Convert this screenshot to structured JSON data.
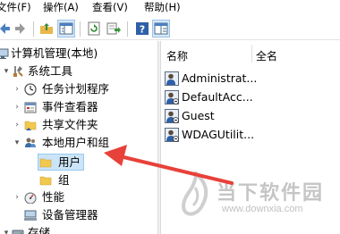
{
  "menu": [
    "文件(F)",
    "操作(A)",
    "查看(V)",
    "帮助(H)"
  ],
  "toolbar": {
    "buttons": [
      "back-icon",
      "forward-icon",
      "up-folder-icon",
      "show-tree-icon",
      "refresh-icon",
      "export-list-icon",
      "help-icon",
      "properties-icon"
    ]
  },
  "tree": {
    "root": "计算机管理(本地)",
    "system_tools": "系统工具",
    "task_scheduler": "任务计划程序",
    "event_viewer": "事件查看器",
    "shared_folders": "共享文件夹",
    "local_users_groups": "本地用户和组",
    "users": "用户",
    "groups": "组",
    "performance": "性能",
    "device_manager": "设备管理器",
    "storage": "存储"
  },
  "list": {
    "columns": [
      "名称",
      "全名"
    ],
    "rows": [
      "Administrat...",
      "DefaultAcc...",
      "Guest",
      "WDAGUtilit..."
    ]
  },
  "watermark": {
    "brand": "当下软件园",
    "url": "www.downxia.com"
  },
  "colors": {
    "arrow": "#e8413a",
    "selection": "#cce4f7",
    "folder": "#f2c94c"
  }
}
